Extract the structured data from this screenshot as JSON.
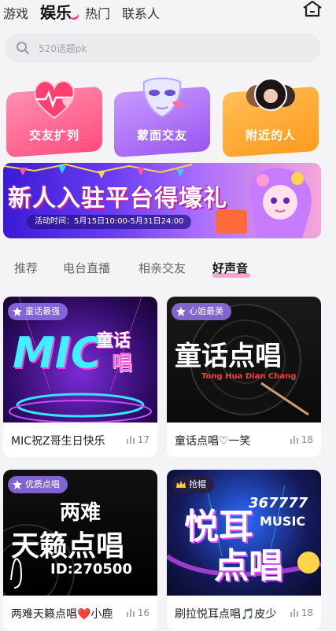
{
  "topnav": {
    "tabs": [
      {
        "label": "游戏"
      },
      {
        "label": "娱乐"
      },
      {
        "label": "热门"
      },
      {
        "label": "联系人"
      }
    ],
    "active": "娱乐"
  },
  "search": {
    "placeholder": "520话题pk"
  },
  "quick": [
    {
      "label": "交友扩列",
      "icon": "heart-icon",
      "color": "#ff5d8f"
    },
    {
      "label": "蒙面交友",
      "icon": "mask-icon",
      "color": "#b06cf5"
    },
    {
      "label": "附近的人",
      "icon": "people-icon",
      "color": "#ffa23a"
    }
  ],
  "banner": {
    "title": "新人入驻平台得壕礼",
    "time": "活动时间：5月15日10:00-5月31日24:00"
  },
  "subtabs": [
    {
      "label": "推荐"
    },
    {
      "label": "电台直播"
    },
    {
      "label": "相亲交友"
    },
    {
      "label": "好声音"
    }
  ],
  "rooms": [
    {
      "tag": "童话最强",
      "name": "MIC祝Z哥生日快乐",
      "count": "17",
      "cover_a": "MIC",
      "cover_b": "童话",
      "cover_c": "唱"
    },
    {
      "tag": "心姐最美",
      "name": "童话点唱♡一笑",
      "count": "18",
      "cover_a": "童话点唱",
      "cover_b": "Tong Hua Dian Chang"
    },
    {
      "tag": "优质点唱",
      "name": "两难天籁点唱❤️小鹿",
      "count": "16",
      "cover_a": "两难",
      "cover_b": "天籁点唱",
      "cover_c": "ID:270500"
    },
    {
      "tag": "抢帽",
      "name": "刷拉悦耳点唱🎵皮少",
      "count": "18",
      "cover_a": "悦耳",
      "cover_b": "点唱",
      "cover_c": "367777",
      "cover_d": "MUSIC"
    }
  ]
}
